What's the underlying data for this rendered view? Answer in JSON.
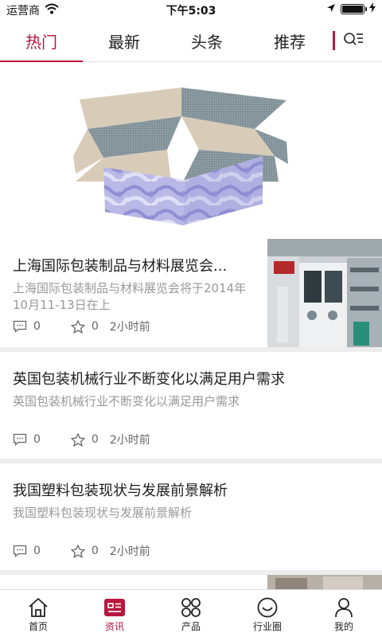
{
  "status_bar": {
    "carrier": "运营商",
    "time": "下午5:03",
    "battery_level": 1.0,
    "icons": [
      "wifi-icon",
      "location-arrow-icon",
      "battery-icon",
      "charging-icon"
    ]
  },
  "tabs": [
    {
      "label": "热门",
      "active": true
    },
    {
      "label": "最新",
      "active": false
    },
    {
      "label": "头条",
      "active": false
    },
    {
      "label": "推荐",
      "active": false
    }
  ],
  "accent_color": "#b8173f",
  "articles": [
    {
      "title": "上海国际包装制品与材料展览会...",
      "summary": "上海国际包装制品与材料展览会将于2014年10月11-13日在上",
      "comments": "0",
      "stars": "0",
      "time": "2小时前",
      "thumbnail": "printing-machine-photo"
    },
    {
      "title": "英国包装机械行业不断变化以满足用户需求",
      "summary": "英国包装机械行业不断变化以满足用户需求",
      "comments": "0",
      "stars": "0",
      "time": "2小时前"
    },
    {
      "title": "我国塑料包装现状与发展前景解析",
      "summary": "我国塑料包装现状与发展前景解析",
      "comments": "0",
      "stars": "0",
      "time": "2小时前"
    }
  ],
  "bottom_nav": [
    {
      "label": "首页",
      "icon": "home-icon",
      "active": false
    },
    {
      "label": "资讯",
      "icon": "news-icon",
      "active": true
    },
    {
      "label": "产品",
      "icon": "grid-icon",
      "active": false
    },
    {
      "label": "行业圈",
      "icon": "smile-icon",
      "active": false
    },
    {
      "label": "我的",
      "icon": "user-icon",
      "active": false
    }
  ]
}
